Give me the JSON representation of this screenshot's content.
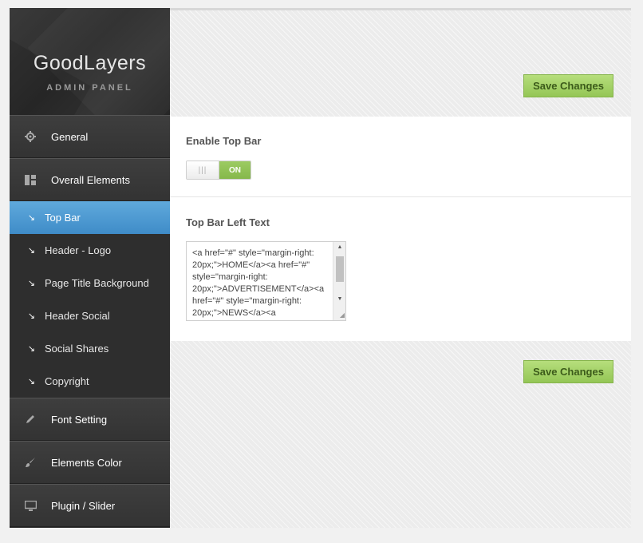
{
  "brand": {
    "title": "GoodLayers",
    "subtitle": "ADMIN PANEL"
  },
  "sidebar": {
    "items": [
      {
        "label": "General",
        "icon": "gear-icon"
      },
      {
        "label": "Overall Elements",
        "icon": "layout-icon"
      }
    ],
    "sub_items": [
      {
        "label": "Top Bar",
        "active": true
      },
      {
        "label": "Header - Logo"
      },
      {
        "label": "Page Title Background"
      },
      {
        "label": "Header Social"
      },
      {
        "label": "Social Shares"
      },
      {
        "label": "Copyright"
      }
    ],
    "bottom_items": [
      {
        "label": "Font Setting",
        "icon": "pencil-icon"
      },
      {
        "label": "Elements Color",
        "icon": "brush-icon"
      },
      {
        "label": "Plugin / Slider",
        "icon": "monitor-icon"
      }
    ]
  },
  "actions": {
    "save_label": "Save Changes"
  },
  "settings": {
    "enable_top_bar": {
      "label": "Enable Top Bar",
      "knob": "|||",
      "state": "ON"
    },
    "top_bar_left_text": {
      "label": "Top Bar Left Text",
      "value": "<a href=\"#\" style=\"margin-right: 20px;\">HOME</a><a href=\"#\" style=\"margin-right: 20px;\">ADVERTISEMENT</a><a href=\"#\" style=\"margin-right: 20px;\">NEWS</a><a"
    }
  },
  "colors": {
    "accent_blue": "#4a9ad4",
    "save_green": "#a6d26a",
    "sidebar_bg": "#2e2e2e"
  }
}
